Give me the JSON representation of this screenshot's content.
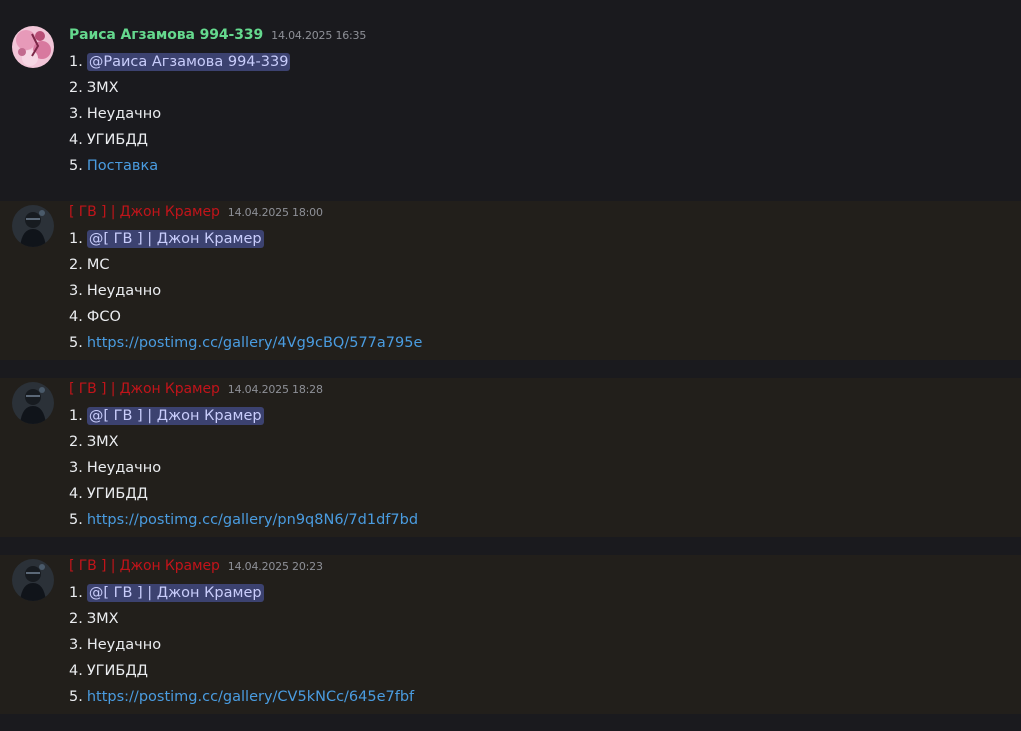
{
  "messages": [
    {
      "author": "Раиса Агзамова 994-339",
      "timestamp": "14.04.2025 16:35",
      "lines": [
        {
          "num": "1.",
          "text": "@Раиса Агзамова 994-339"
        },
        {
          "num": "2.",
          "text": "ЗМХ"
        },
        {
          "num": "3.",
          "text": "Неудачно"
        },
        {
          "num": "4.",
          "text": "УГИБДД"
        },
        {
          "num": "5.",
          "text": "Поставка"
        }
      ]
    },
    {
      "author": "[ ГВ ] | Джон Крамер",
      "timestamp": "14.04.2025 18:00",
      "lines": [
        {
          "num": "1.",
          "text": "@[ ГВ ] | Джон Крамер"
        },
        {
          "num": "2.",
          "text": "МС"
        },
        {
          "num": "3.",
          "text": "Неудачно"
        },
        {
          "num": "4.",
          "text": "ФСО"
        },
        {
          "num": "5.",
          "text": "https://postimg.cc/gallery/4Vg9cBQ/577a795e"
        }
      ]
    },
    {
      "author": "[ ГВ ] | Джон Крамер",
      "timestamp": "14.04.2025 18:28",
      "lines": [
        {
          "num": "1.",
          "text": "@[ ГВ ] | Джон Крамер"
        },
        {
          "num": "2.",
          "text": "ЗМХ"
        },
        {
          "num": "3.",
          "text": "Неудачно"
        },
        {
          "num": "4.",
          "text": "УГИБДД"
        },
        {
          "num": "5.",
          "text": "https://postimg.cc/gallery/pn9q8N6/7d1df7bd"
        }
      ]
    },
    {
      "author": "[ ГВ ] | Джон Крамер",
      "timestamp": "14.04.2025 20:23",
      "lines": [
        {
          "num": "1.",
          "text": "@[ ГВ ] | Джон Крамер"
        },
        {
          "num": "2.",
          "text": "ЗМХ"
        },
        {
          "num": "3.",
          "text": "Неудачно"
        },
        {
          "num": "4.",
          "text": "УГИБДД"
        },
        {
          "num": "5.",
          "text": "https://postimg.cc/gallery/CV5kNCc/645e7fbf"
        }
      ]
    }
  ],
  "colors": {
    "background": "#1a1a1e",
    "highlight_background": "#221f1b",
    "author_green": "#65d98e",
    "author_red": "#c1141a",
    "mention_bg": "#3c4270",
    "link": "#4a9ce0"
  },
  "icons": {
    "avatar_1": "pink-floral-avatar-icon",
    "avatar_2": "dark-figure-avatar-icon"
  }
}
